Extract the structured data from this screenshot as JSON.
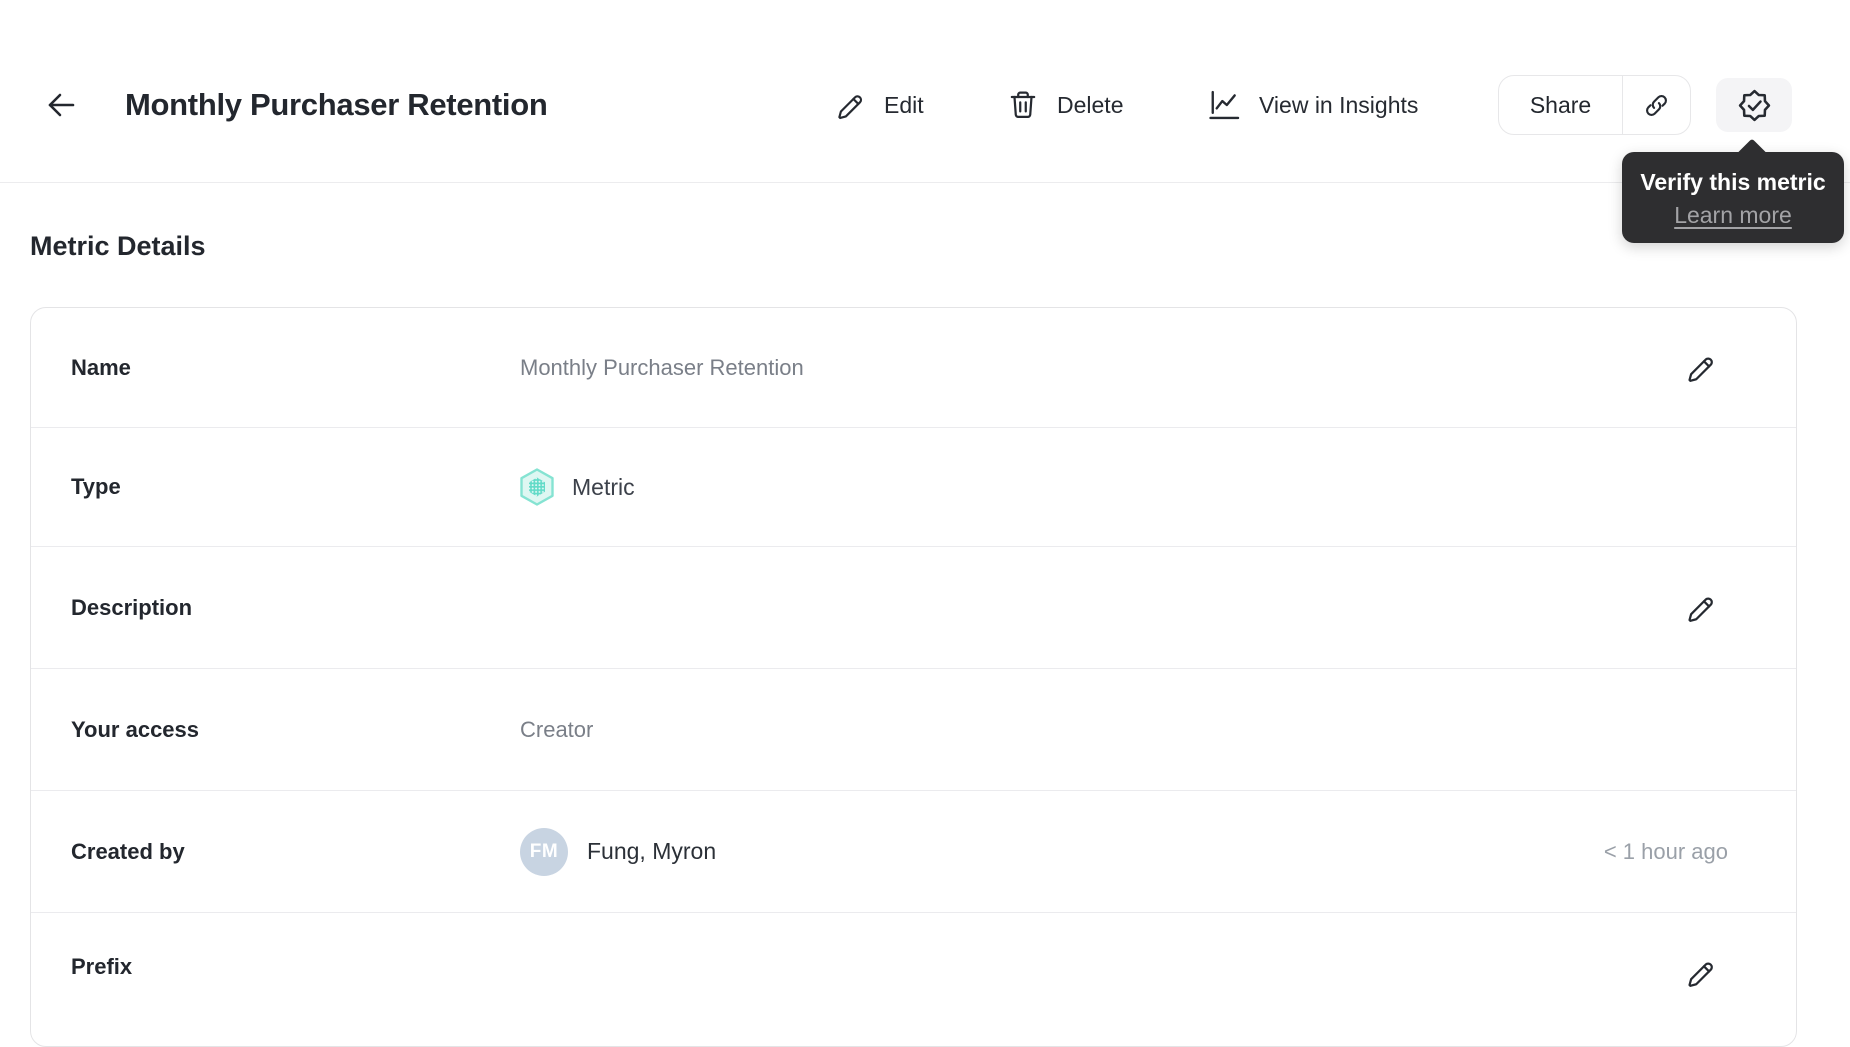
{
  "header": {
    "title": "Monthly Purchaser Retention",
    "actions": {
      "edit": "Edit",
      "delete": "Delete",
      "view_in_insights": "View in Insights",
      "share": "Share"
    },
    "icons": [
      "back-arrow-icon",
      "pencil-icon",
      "trash-icon",
      "insights-chart-icon",
      "link-icon",
      "verify-badge-icon"
    ]
  },
  "tooltip": {
    "title": "Verify this metric",
    "link_label": "Learn more"
  },
  "section_heading": "Metric Details",
  "metric_details": {
    "rows": {
      "name": {
        "label": "Name",
        "value": "Monthly Purchaser Retention"
      },
      "type": {
        "label": "Type",
        "value": "Metric",
        "icon": "metric-hexagon-icon"
      },
      "description": {
        "label": "Description",
        "value": ""
      },
      "your_access": {
        "label": "Your access",
        "value": "Creator"
      },
      "created_by": {
        "label": "Created by",
        "value": "Fung, Myron",
        "avatar_initials": "FM",
        "timestamp": "< 1 hour ago"
      },
      "prefix": {
        "label": "Prefix",
        "value": ""
      }
    }
  },
  "colors": {
    "accent_teal": "#62dbc8",
    "accent_teal_light": "#def7f2",
    "accent_teal_border": "#85e3d2",
    "tooltip_bg": "#2e2e30",
    "avatar_bg": "#c8d4e2",
    "text_dark": "#23272e",
    "text_gray": "#7a7f88",
    "timestamp_gray": "#9aa0a8",
    "card_border": "#e4e4e6",
    "verify_btn_bg": "#f4f4f6"
  }
}
